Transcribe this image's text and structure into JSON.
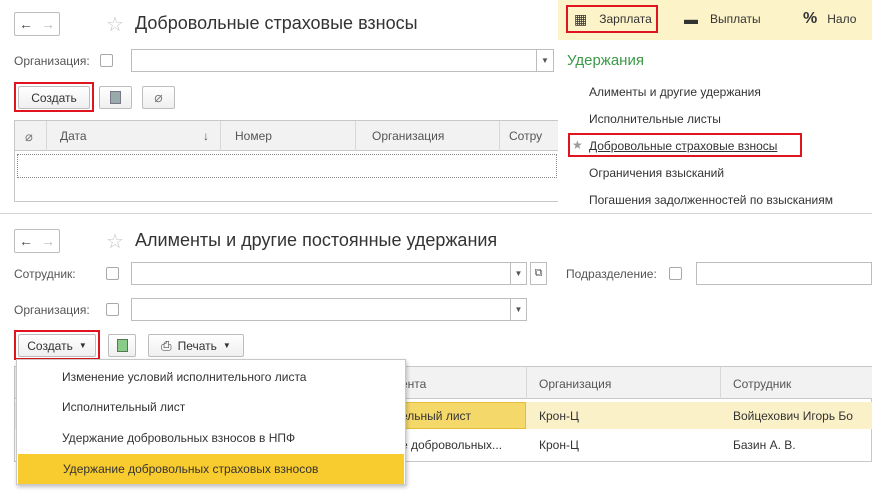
{
  "top_window": {
    "title": "Добровольные страховые взносы",
    "org_label": "Организация:",
    "create_label": "Создать",
    "columns": [
      "Дата",
      "↓",
      "Номер",
      "Организация",
      "Сотру"
    ]
  },
  "section_panel": {
    "tabs": [
      {
        "icon": "▦",
        "label": "Зарплата"
      },
      {
        "icon": "▬",
        "label": "Выплаты"
      },
      {
        "icon": "%",
        "label": "Нало"
      }
    ],
    "heading": "Удержания",
    "items": [
      "Алименты и другие удержания",
      "Исполнительные листы",
      "Добровольные страховые взносы",
      "Ограничения взысканий",
      "Погашения задолженностей по взысканиям"
    ]
  },
  "bottom_window": {
    "title": "Алименты и другие постоянные удержания",
    "employee_label": "Сотрудник:",
    "department_label": "Подразделение:",
    "org_label": "Организация:",
    "create_label": "Создать",
    "print_label": "Печать",
    "columns": [
      "ента",
      "Организация",
      "Сотрудник"
    ],
    "rows": [
      [
        "ельный лист",
        "Крон-Ц",
        "Войцехович Игорь Бо"
      ],
      [
        "е добровольных...",
        "Крон-Ц",
        "Базин А. В."
      ]
    ]
  },
  "create_menu": {
    "items": [
      "Изменение условий исполнительного листа",
      "Исполнительный лист",
      "Удержание добровольных взносов в НПФ",
      "Удержание добровольных страховых взносов"
    ]
  }
}
